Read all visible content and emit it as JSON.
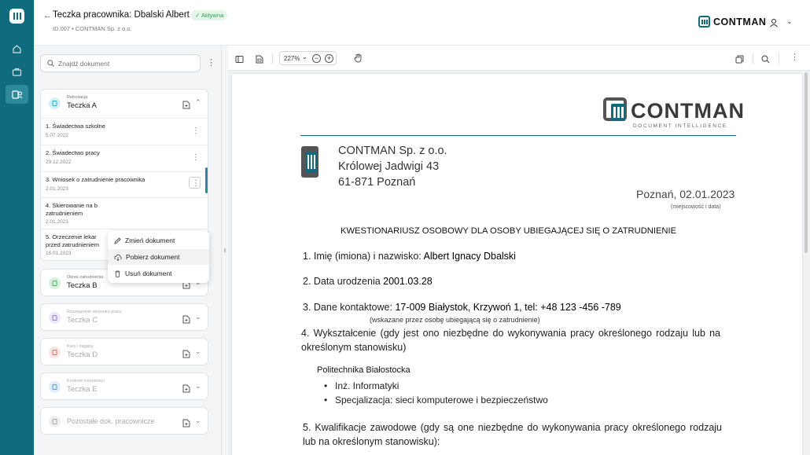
{
  "header": {
    "back_icon": "arrow-left-icon",
    "title": "Teczka pracownika: Dbalski Albert",
    "status_badge": "✓ Aktywna",
    "subtitle": "ID.007 • CONTMAN Sp. z o.o.",
    "brand": "CONTMAN",
    "colors": {
      "accent": "#0f6b7d",
      "badge_bg": "#e3f6e8",
      "badge_text": "#2e9d55"
    }
  },
  "rail": {
    "items": [
      {
        "icon": "home-icon"
      },
      {
        "icon": "briefcase-icon"
      },
      {
        "icon": "employees-icon",
        "active": true
      }
    ]
  },
  "sidebar": {
    "search_placeholder": "Znajdź dokument",
    "folders": [
      {
        "category": "Rekrutacja",
        "name": "Teczka A",
        "expanded": true,
        "color": "#2aa8c9",
        "documents": [
          {
            "name": "1. Świadectwa szkolne",
            "date": "5.07.2022"
          },
          {
            "name": "2. Świadectwo pracy",
            "date": "29.12.2022"
          },
          {
            "name": "3. Wniosek o zatrudnienie pracownika",
            "date": "2.01.2023",
            "selected": true
          },
          {
            "name_line1": "4. Skierowanie na b",
            "name_line2": "zatrudnieniem",
            "date": "2.01.2023"
          },
          {
            "name_line1": "5. Orzeczenie lekar",
            "name_line2": "przed zatrudnieniem",
            "date": "15.01.2023"
          }
        ]
      },
      {
        "category": "Okres zatrudnienia",
        "name": "Teczka B",
        "color": "#3cb86a"
      },
      {
        "category": "Rozwiązanie stosunku pracy",
        "name": "Teczka C",
        "color": "#8e7ad6"
      },
      {
        "category": "Kary i nagany",
        "name": "Teczka D",
        "color": "#e06a6a"
      },
      {
        "category": "Kontrole trzeźwości",
        "name": "Teczka E",
        "color": "#4a9de0"
      },
      {
        "name": "Pozostałe dok. pracownicze",
        "color": "#aaaaaa"
      }
    ],
    "context_menu": {
      "items": [
        {
          "label": "Zmień dokument",
          "icon": "pencil-icon"
        },
        {
          "label": "Pobierz dokument",
          "icon": "cloud-download-icon"
        },
        {
          "label": "Usuń dokument",
          "icon": "trash-icon"
        }
      ]
    }
  },
  "viewer": {
    "zoom": "227%",
    "zoom_chevron": "⌄",
    "zoom_out": "−",
    "zoom_in": "+"
  },
  "document": {
    "logo_text": "CONTMAN",
    "logo_tagline": "DOCUMENT INTELLIGENCE",
    "company_name": "CONTMAN Sp. z o.o.",
    "company_street": "Królowej Jadwigi 43",
    "company_city": "61-871 Poznań",
    "place_date": "Poznań, 02.01.2023",
    "place_date_note": "(miejscowość i data)",
    "title": "KWESTIONARIUSZ OSOBOWY DLA OSOBY UBIEGAJĄCEJ SIĘ O ZATRUDNIENIE",
    "q1_label": "1. Imię (imiona) i nazwisko: ",
    "q1_value": "Albert Ignacy Dbalski",
    "q2_label": "2. Data urodzenia ",
    "q2_value": "2001.03.28",
    "q3_label": "3. Dane kontaktowe: ",
    "q3_value": "17-009 Białystok, Krzywoń 1, tel: +48 123 -456 -789",
    "q3_note": "(wskazane przez osobę ubiegającą się o zatrudnienie)",
    "q4": "4. Wykształcenie (gdy jest ono niezbędne do wykonywania pracy określonego rodzaju lub na określonym stanowisku)",
    "education_school": "Politechnika Białostocka",
    "education_items": [
      "Inż. Informatyki",
      "Specjalizacja: sieci komputerowe i bezpieczeństwo"
    ],
    "q5": "5. Kwalifikacje zawodowe (gdy są one niezbędne do wykonywania pracy określonego rodzaju lub na określonym stanowisku):"
  }
}
